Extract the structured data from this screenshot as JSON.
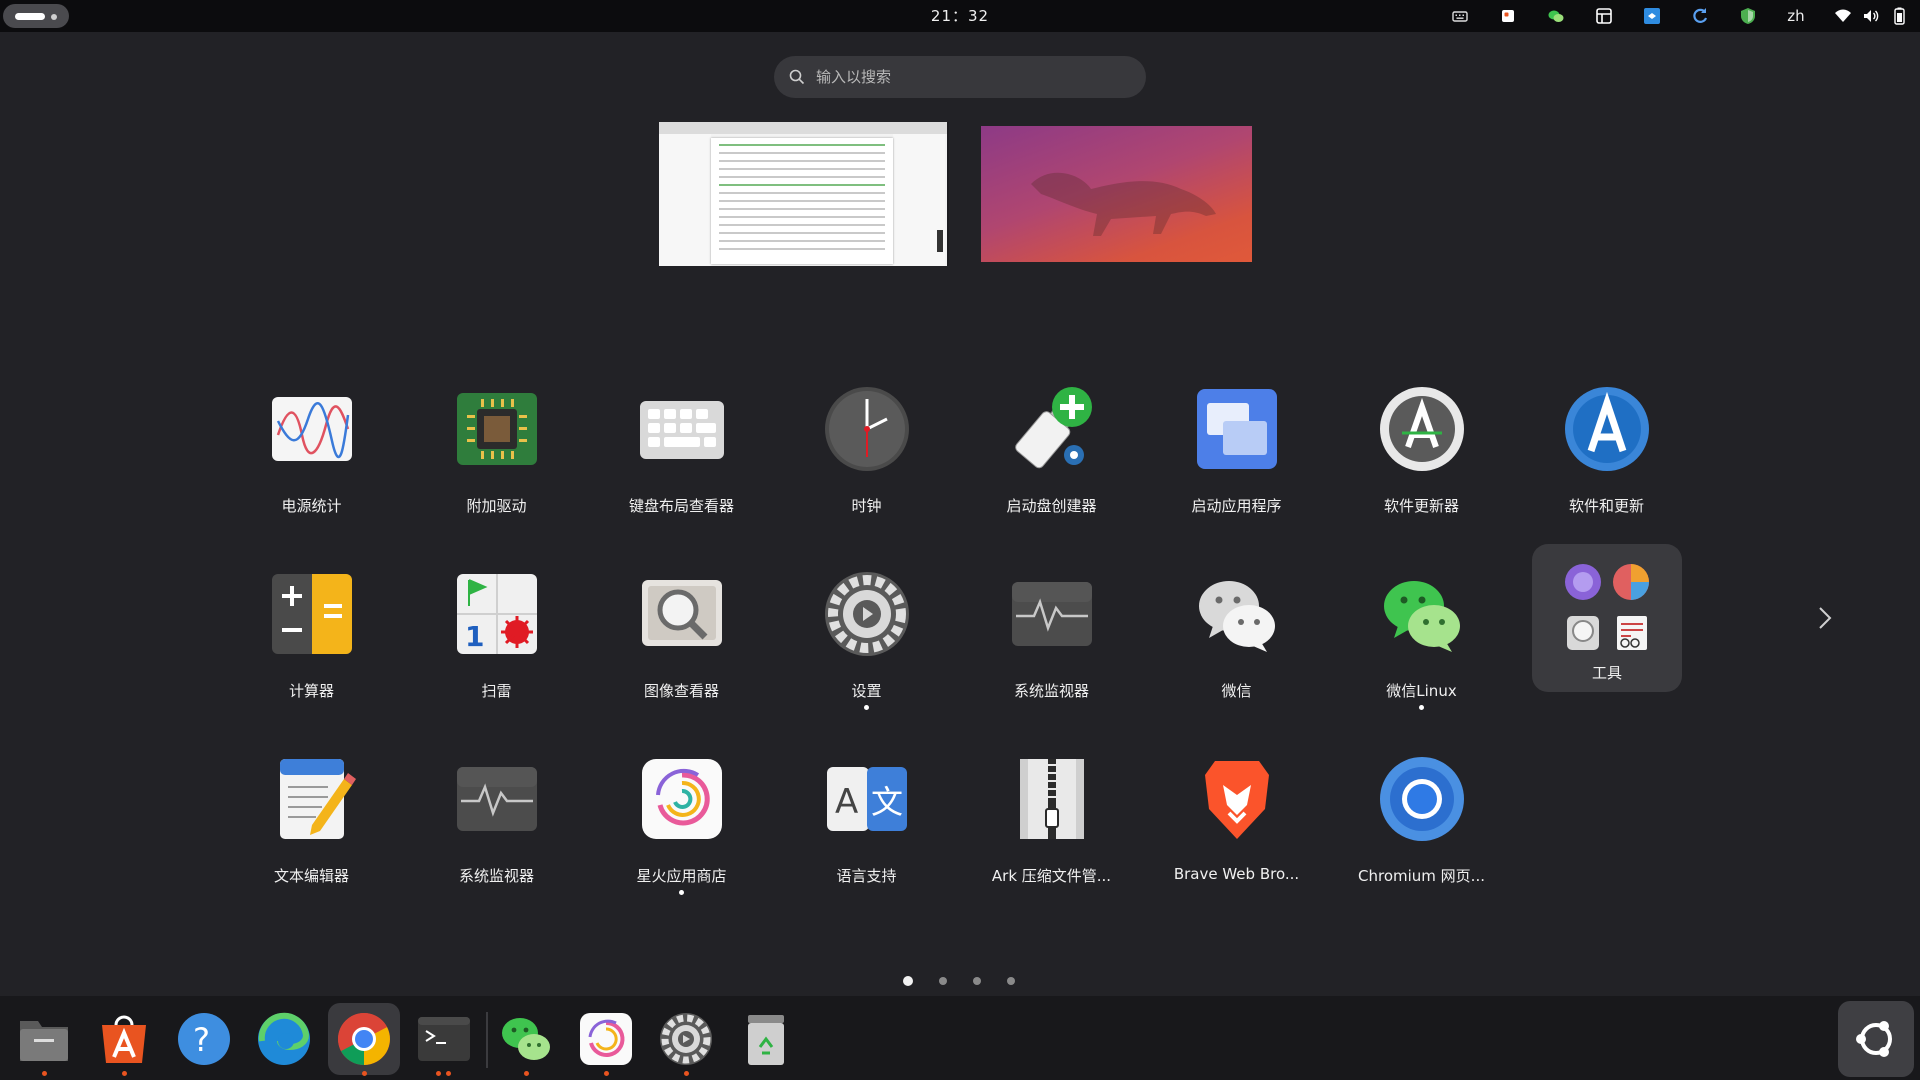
{
  "topbar": {
    "clock": "21：32",
    "tray_icons": [
      "keyboard-icon",
      "note-icon",
      "wechat-tray-icon",
      "screenshot-icon",
      "vscode-tray-icon",
      "refresh-icon",
      "shield-icon"
    ],
    "input_method": "zh",
    "system_icons": [
      "wifi-icon",
      "volume-icon",
      "battery-icon"
    ]
  },
  "search": {
    "placeholder": "输入以搜索"
  },
  "workspaces": [
    "ws-document-window",
    "ws-empty-desktop"
  ],
  "apps": [
    {
      "label": "电源统计",
      "icon": "power-statistics-icon",
      "running": false
    },
    {
      "label": "附加驱动",
      "icon": "additional-drivers-icon",
      "running": false
    },
    {
      "label": "键盘布局查看器",
      "icon": "keyboard-layout-icon",
      "running": false
    },
    {
      "label": "时钟",
      "icon": "clock-icon",
      "running": false
    },
    {
      "label": "启动盘创建器",
      "icon": "startup-disk-creator-icon",
      "running": false
    },
    {
      "label": "启动应用程序",
      "icon": "startup-apps-icon",
      "running": false
    },
    {
      "label": "软件更新器",
      "icon": "software-updater-icon",
      "running": false
    },
    {
      "label": "软件和更新",
      "icon": "software-properties-icon",
      "running": false
    },
    {
      "label": "计算器",
      "icon": "calculator-icon",
      "running": false
    },
    {
      "label": "扫雷",
      "icon": "mines-icon",
      "running": false
    },
    {
      "label": "图像查看器",
      "icon": "image-viewer-icon",
      "running": false
    },
    {
      "label": "设置",
      "icon": "settings-icon",
      "running": true
    },
    {
      "label": "系统监视器",
      "icon": "system-monitor-icon",
      "running": false
    },
    {
      "label": "微信",
      "icon": "wechat-icon",
      "running": false
    },
    {
      "label": "微信Linux",
      "icon": "wechat-linux-icon",
      "running": true
    },
    {
      "label": "工具",
      "icon": "tools-folder-icon",
      "running": false,
      "folder": true
    },
    {
      "label": "文本编辑器",
      "icon": "text-editor-icon",
      "running": false
    },
    {
      "label": "系统监视器",
      "icon": "system-monitor-icon",
      "running": false
    },
    {
      "label": "星火应用商店",
      "icon": "spark-store-icon",
      "running": true
    },
    {
      "label": "语言支持",
      "icon": "language-support-icon",
      "running": false
    },
    {
      "label": "Ark 压缩文件管...",
      "icon": "ark-archiver-icon",
      "running": false
    },
    {
      "label": "Brave Web Bro...",
      "icon": "brave-icon",
      "running": false
    },
    {
      "label": "Chromium 网页...",
      "icon": "chromium-icon",
      "running": false
    }
  ],
  "pagination": {
    "pages": 4,
    "current": 1
  },
  "dock": [
    {
      "name": "files",
      "icon": "files-icon",
      "running": true,
      "windows": 1
    },
    {
      "name": "app-center",
      "icon": "app-center-icon",
      "running": true,
      "windows": 1
    },
    {
      "name": "help",
      "icon": "help-icon",
      "running": false,
      "windows": 0
    },
    {
      "name": "edge",
      "icon": "edge-icon",
      "running": false,
      "windows": 0
    },
    {
      "name": "chrome",
      "icon": "chrome-icon",
      "running": true,
      "windows": 1,
      "active": true
    },
    {
      "name": "terminal",
      "icon": "terminal-icon",
      "running": true,
      "windows": 2
    },
    {
      "name": "wechat",
      "icon": "wechat-dock-icon",
      "running": true,
      "windows": 1
    },
    {
      "name": "spark-store",
      "icon": "spark-store-dock-icon",
      "running": true,
      "windows": 1
    },
    {
      "name": "settings",
      "icon": "settings-dock-icon",
      "running": true,
      "windows": 1
    },
    {
      "name": "trash",
      "icon": "trash-icon",
      "running": false,
      "windows": 0
    }
  ],
  "colors": {
    "accent": "#e95420",
    "panel": "#0c0c0e",
    "background": "#222226"
  }
}
